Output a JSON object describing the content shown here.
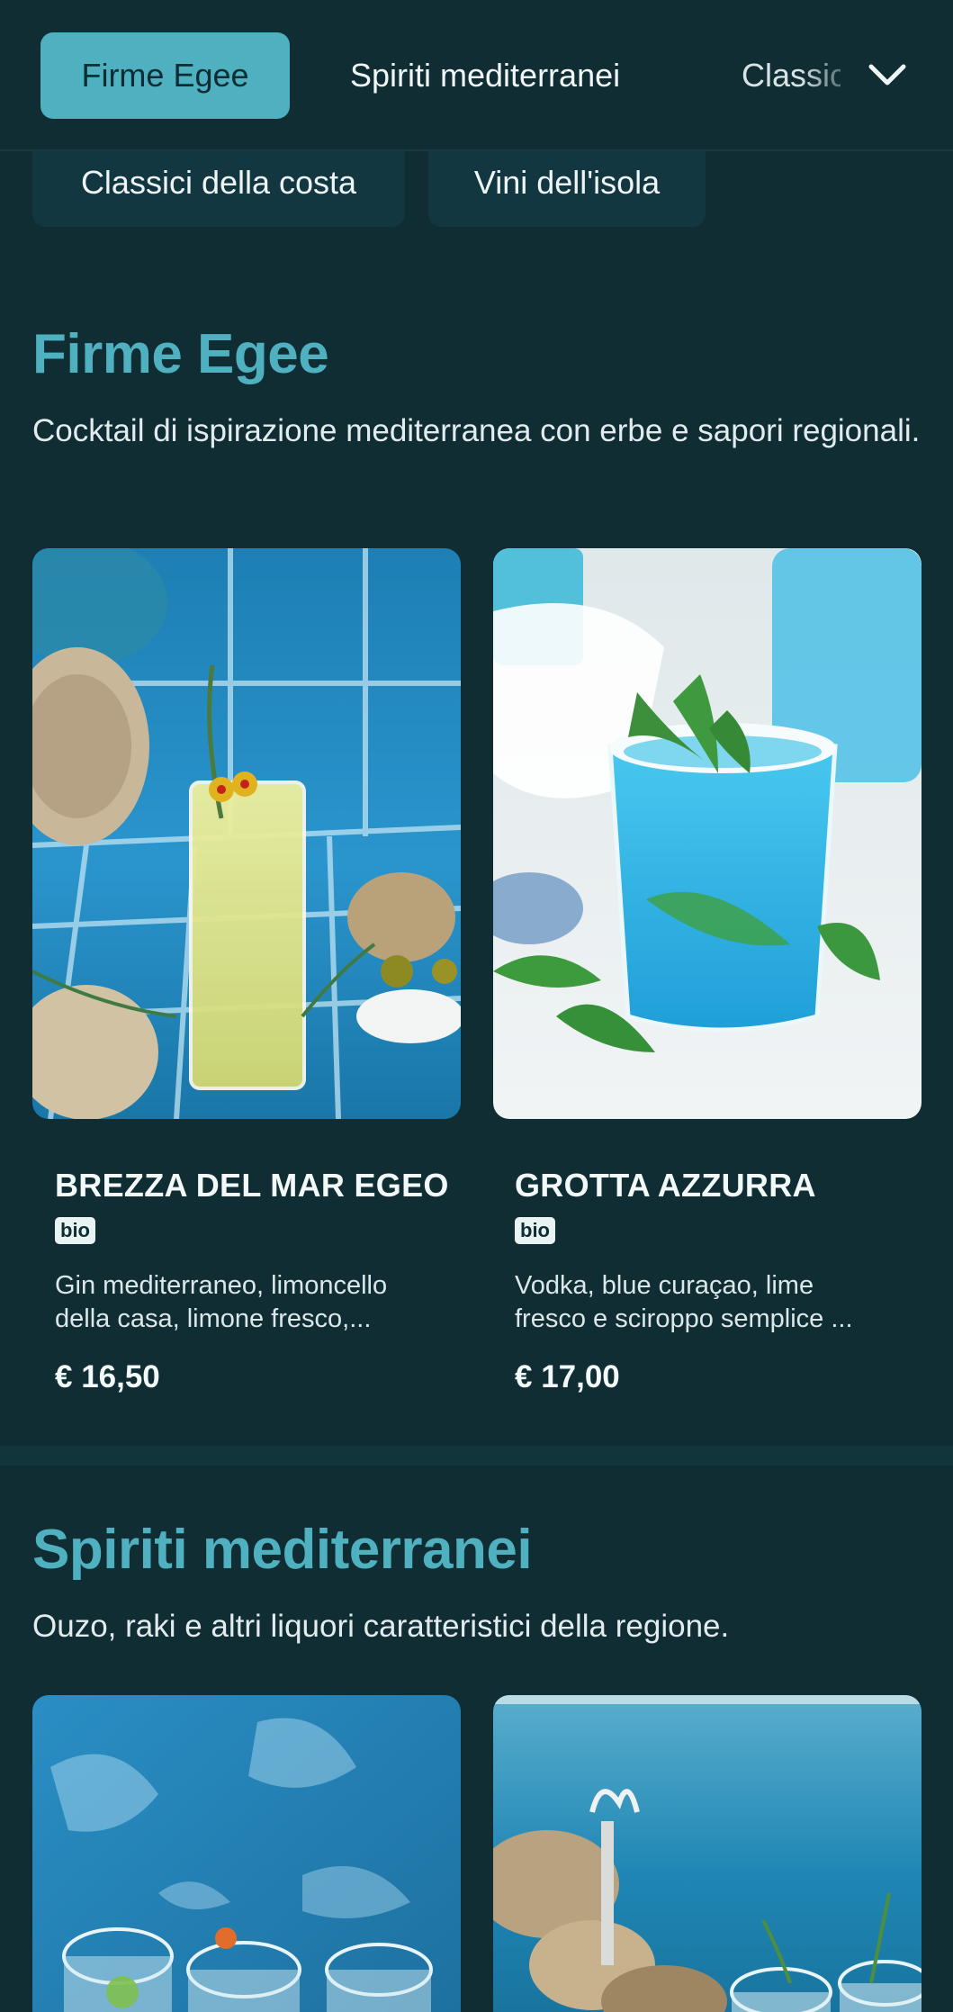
{
  "nav": {
    "tabs": [
      {
        "label": "Firme Egee",
        "active": true
      },
      {
        "label": "Spiriti mediterranei",
        "active": false
      },
      {
        "label": "Classici della costa",
        "active": false
      }
    ],
    "expand_icon": "chevron-down-icon",
    "more_chips": [
      {
        "label": "Classici della costa"
      },
      {
        "label": "Vini dell'isola"
      }
    ]
  },
  "sections": [
    {
      "title": "Firme Egee",
      "description": "Cocktail di ispirazione mediterranea con erbe e sapori regionali.",
      "items": [
        {
          "name": "BREZZA DEL MAR EGEO",
          "badge": "bio",
          "description_line1": "Gin mediterraneo, limoncello",
          "description_line2": "della casa, limone fresco,...",
          "price": "€ 16,50"
        },
        {
          "name": "GROTTA AZZURRA",
          "badge": "bio",
          "description_line1": "Vodka, blue curaçao, lime",
          "description_line2": "fresco e sciroppo semplice ...",
          "price": "€ 17,00"
        }
      ]
    },
    {
      "title": "Spiriti mediterranei",
      "description": "Ouzo, raki e altri liquori caratteristici della regione."
    }
  ],
  "colors": {
    "background": "#0f2d33",
    "accent": "#4fb0bf",
    "active_tab_text": "#0e2c33",
    "text": "#e8f1f2"
  }
}
